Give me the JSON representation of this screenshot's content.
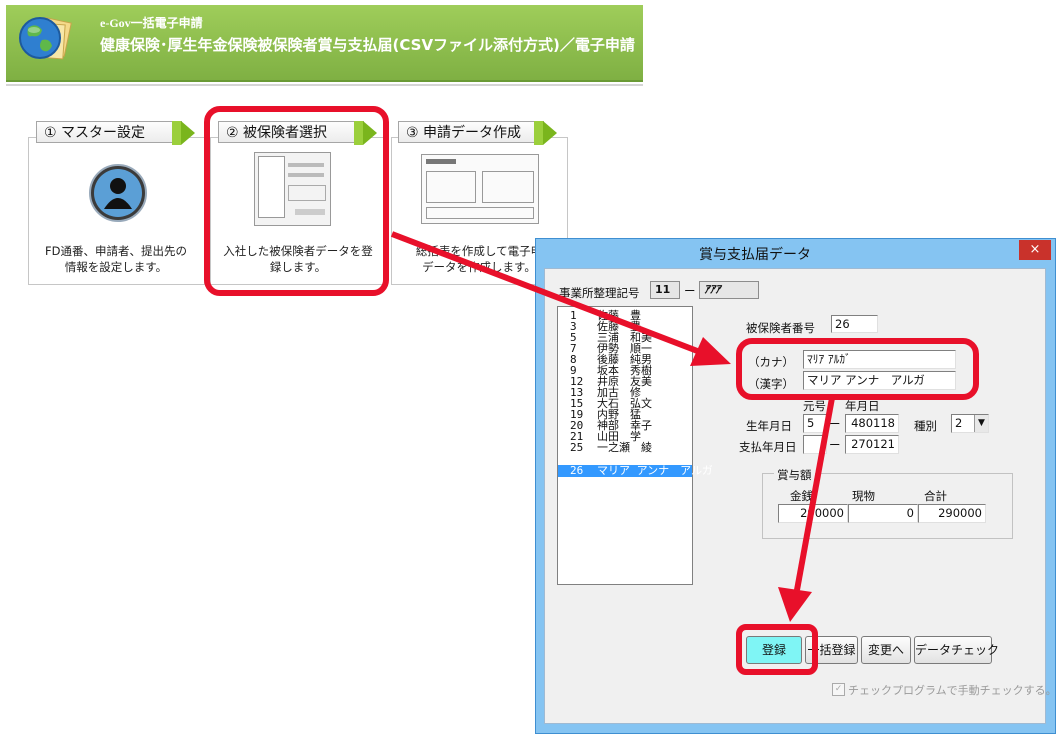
{
  "header": {
    "app_name": "e-Gov一括電子申請",
    "title": "健康保険･厚生年金保険被保険者賞与支払届(CSVファイル添付方式)／電子申請"
  },
  "steps": [
    {
      "label": "① マスター設定",
      "desc_lines": [
        "FD通番、申請者、提出先の",
        "情報を設定します。"
      ]
    },
    {
      "label": "② 被保険者選択",
      "desc_lines": [
        "入社した被保険者データを登",
        "録します。"
      ]
    },
    {
      "label": "③ 申請データ作成",
      "desc_lines": [
        "総括表を作成して電子申",
        "データを作成します。"
      ]
    }
  ],
  "dialog": {
    "title": "賞与支払届データ",
    "close_glyph": "×",
    "office_label": "事業所整理記号",
    "office_code": "11",
    "dash": "ー",
    "office_symbol": "ｱｱｱ",
    "employees": [
      {
        "num": "1",
        "name": "佐藤　豊"
      },
      {
        "num": "3",
        "name": "佐藤　豊"
      },
      {
        "num": "5",
        "name": "三浦　和美"
      },
      {
        "num": "7",
        "name": "伊勢　順一"
      },
      {
        "num": "8",
        "name": "後藤　純男"
      },
      {
        "num": "9",
        "name": "坂本　秀樹"
      },
      {
        "num": "12",
        "name": "井原　友美"
      },
      {
        "num": "13",
        "name": "加古　修"
      },
      {
        "num": "15",
        "name": "大石　弘文"
      },
      {
        "num": "19",
        "name": "内野　猛"
      },
      {
        "num": "20",
        "name": "神部　幸子"
      },
      {
        "num": "21",
        "name": "山田　学"
      },
      {
        "num": "25",
        "name": "一之瀬　綾"
      },
      {
        "num": "26",
        "name": "マリア アンナ　アルガ"
      }
    ],
    "insured_no_label": "被保険者番号",
    "insured_no": "26",
    "kana_label": "（カナ）",
    "kana_value": "ﾏﾘｱ ｱﾙｶﾞ",
    "kanji_label": "（漢字）",
    "kanji_value": "マリア アンナ　アルガ",
    "era_header": "元号",
    "ymd_header": "年月日",
    "birth_label": "生年月日",
    "birth_era": "5",
    "birth_date": "480118",
    "kind_label": "種別",
    "kind_value": "2",
    "pay_label": "支払年月日",
    "pay_era": "",
    "pay_date": "270121",
    "bonus_group": "賞与額",
    "col_cash": "金銭",
    "col_goods": "現物",
    "col_total": "合計",
    "cash": "290000",
    "goods": "0",
    "total": "290000",
    "btn_register": "登録",
    "btn_bulk": "一括登録",
    "btn_change": "変更へ",
    "btn_check": "データチェック",
    "manual_check": "チェックプログラムで手動チェックする。"
  },
  "colors": {
    "accent_red": "#e8102a",
    "header_green": "#8bbf4b",
    "selection_blue": "#3399ff"
  }
}
